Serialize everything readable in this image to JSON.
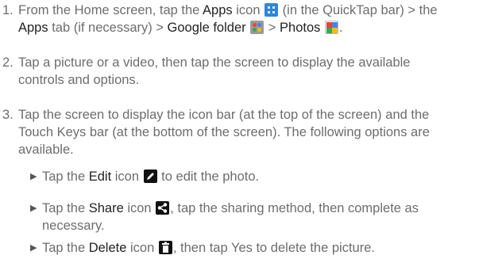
{
  "steps": [
    {
      "num": "1.",
      "line1_a": "From the Home screen, tap the ",
      "apps": "Apps",
      "line1_b": " icon ",
      "line1_c": " (in the QuickTap bar) > the",
      "apps_tab": "Apps",
      "line2_a": " tab (if necessary) > ",
      "google_folder": "Google folder",
      "line2_b": " > ",
      "photos": "Photos",
      "line2_c": "."
    },
    {
      "num": "2.",
      "line1": "Tap a picture or a video, then tap the screen to display the available",
      "line2": "controls and options."
    },
    {
      "num": "3.",
      "line1": "Tap the screen to display the icon bar (at the top of the screen) and the",
      "line2": "Touch Keys bar (at the bottom of the screen). The following options are",
      "line3": "available."
    }
  ],
  "bullets": [
    {
      "pre": "Tap the ",
      "key": "Edit",
      "mid": " icon ",
      "post": " to edit the photo."
    },
    {
      "pre": "Tap the ",
      "key": "Share",
      "mid": " icon ",
      "post": ", tap the sharing method, then complete as",
      "line2": "necessary."
    },
    {
      "pre": "Tap the ",
      "key": "Delete",
      "mid": " icon ",
      "post": ", then tap Yes to delete the picture."
    }
  ],
  "bullet_glyph": "▶",
  "icons": {
    "apps": "apps-grid-icon",
    "google_folder": "google-folder-icon",
    "photos": "photos-icon",
    "edit": "pencil-icon",
    "share": "share-icon",
    "delete": "trash-icon"
  }
}
